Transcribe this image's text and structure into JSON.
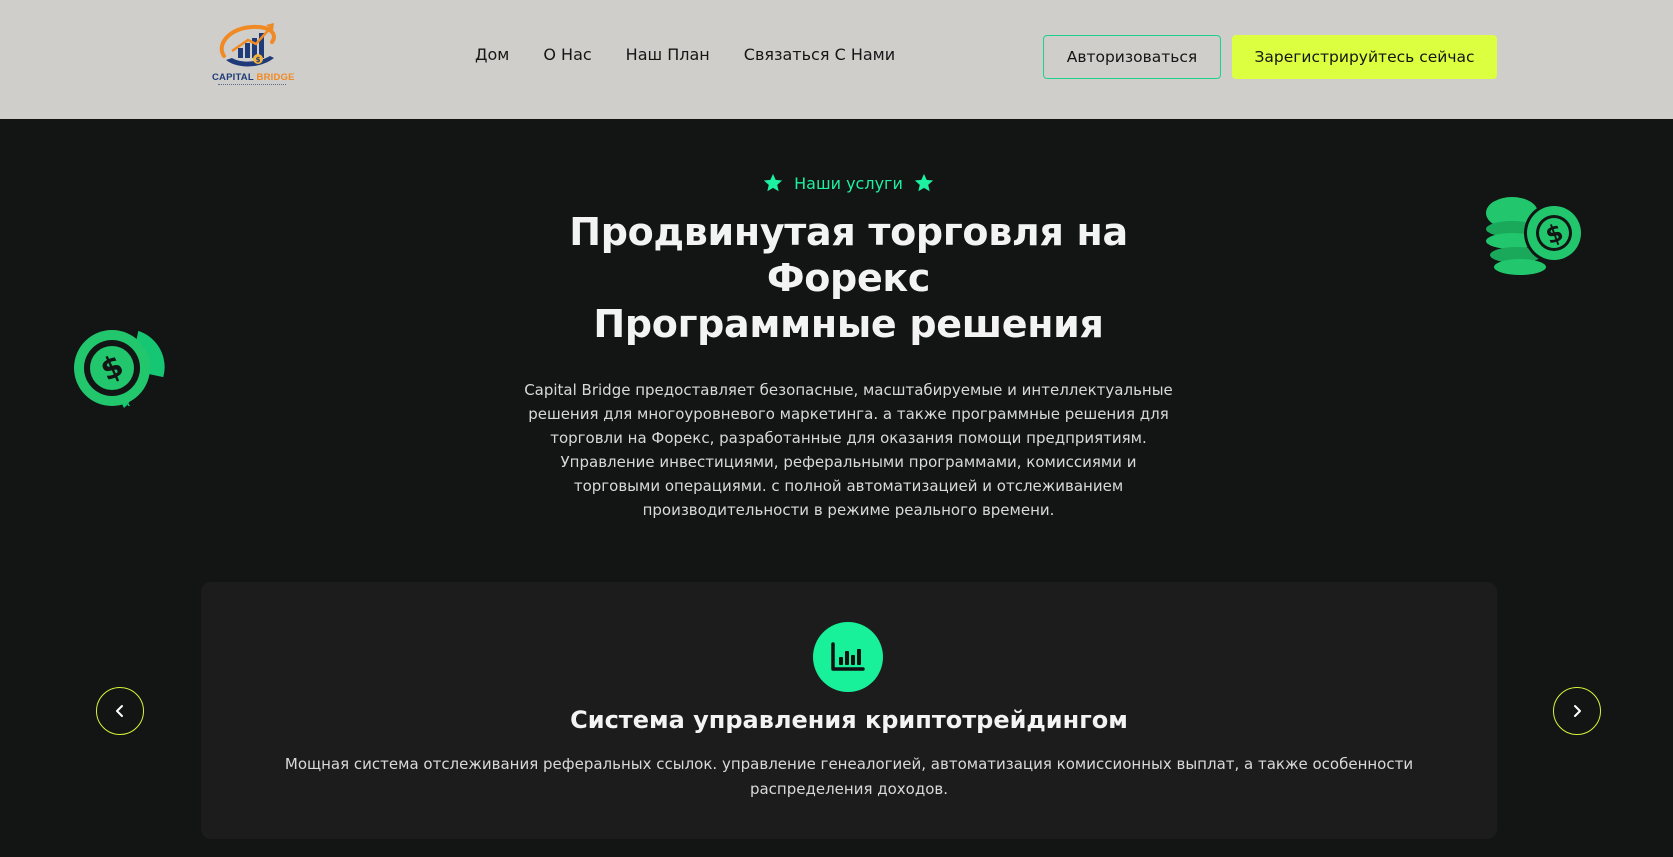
{
  "header": {
    "logo": {
      "brand_word1": "CAPITAL",
      "brand_word2": "BRIDGE"
    },
    "nav": [
      {
        "label": "Дом"
      },
      {
        "label": "О Нас"
      },
      {
        "label": "Наш План"
      },
      {
        "label": "Связаться С Нами"
      }
    ],
    "login_label": "Авторизоваться",
    "register_label": "Зарегистрируйтесь сейчас"
  },
  "hero": {
    "eyebrow": "Наши услуги",
    "title_lines": [
      "Продвинутая торговля на",
      "Форекс",
      "Программные решения"
    ],
    "description": "Capital Bridge предоставляет безопасные, масштабируемые и интеллектуальные решения для многоуровневого маркетинга. а также программные решения для торговли на Форекс, разработанные для оказания помощи предприятиям. Управление инвестициями, реферальными программами, комиссиями и торговыми операциями. с полной автоматизацией и отслеживанием производительности в режиме реального времени."
  },
  "service_card": {
    "icon": "bar-chart-icon",
    "title": "Система управления криптотрейдингом",
    "description": "Мощная система отслеживания реферальных ссылок. управление генеалогией, автоматизация комиссионных выплат, а также особенности распределения доходов."
  },
  "slider": {
    "prev_icon": "chevron-left-icon",
    "next_icon": "chevron-right-icon"
  },
  "colors": {
    "header_bg": "#cfcecb",
    "page_bg": "#131414",
    "card_bg": "#1c1c1c",
    "accent_green": "#19f09a",
    "accent_lime": "#dcff3f",
    "coin_green": "#22c66c"
  }
}
